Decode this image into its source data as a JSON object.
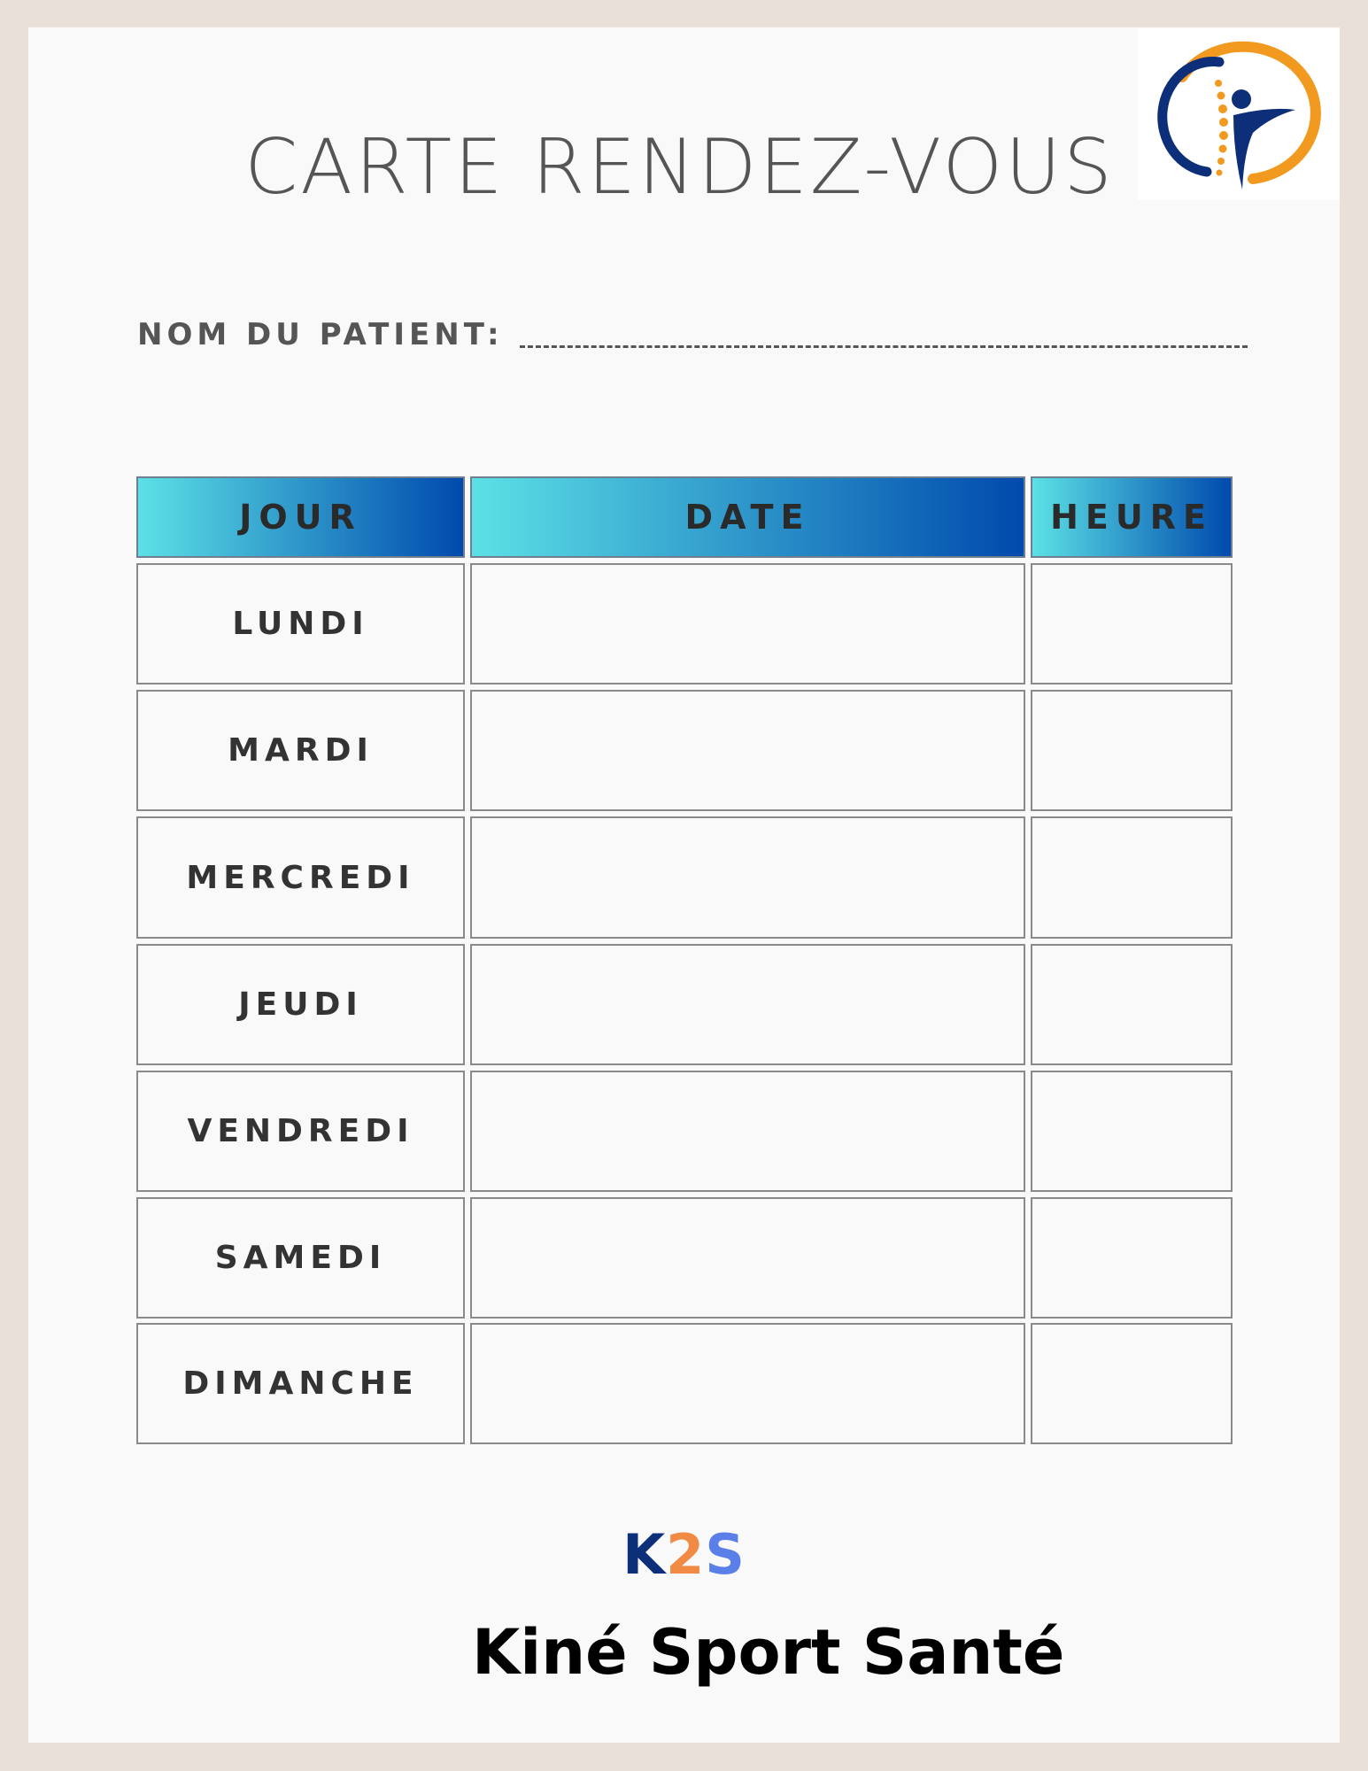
{
  "title": "CARTE RENDEZ-VOUS",
  "patient": {
    "label": "NOM DU PATIENT:"
  },
  "table": {
    "headers": {
      "day": "JOUR",
      "date": "DATE",
      "time": "HEURE"
    },
    "days": [
      "LUNDI",
      "MARDI",
      "MERCREDI",
      "JEUDI",
      "VENDREDI",
      "SAMEDI",
      "DIMANCHE"
    ]
  },
  "footer": {
    "logo_k": "K",
    "logo_2": "2",
    "logo_s": "S",
    "brand_name": "Kiné Sport Santé"
  },
  "colors": {
    "header_gradient_start": "#5ce1e6",
    "header_gradient_end": "#004aad",
    "logo_orange": "#f29a1f",
    "logo_navy": "#0d2f7a",
    "page_border": "#e9e1d9",
    "text_gray": "#555555"
  },
  "icons": {
    "logo": "physiotherapy-spine-figure-logo"
  }
}
